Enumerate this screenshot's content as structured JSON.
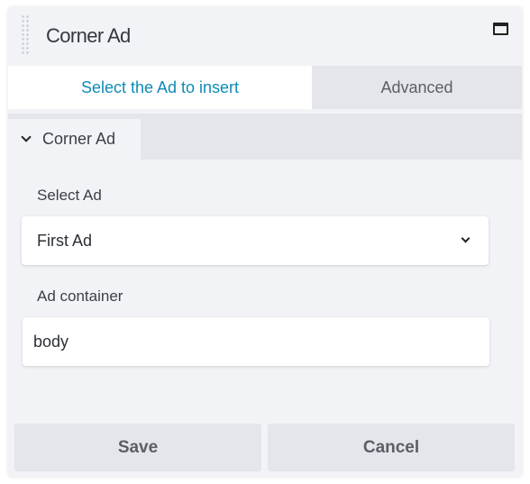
{
  "dialog": {
    "title": "Corner Ad",
    "maximize_icon": "maximize-icon"
  },
  "tabs": [
    {
      "label": "Select the Ad to insert",
      "active": true
    },
    {
      "label": "Advanced",
      "active": false
    }
  ],
  "section": {
    "label": "Corner Ad",
    "icon": "chevron-down-icon"
  },
  "fields": {
    "select_ad": {
      "label": "Select Ad",
      "value": "First Ad"
    },
    "ad_container": {
      "label": "Ad container",
      "value": "body"
    }
  },
  "buttons": {
    "save": "Save",
    "cancel": "Cancel"
  },
  "colors": {
    "accent": "#0e8bb6",
    "panel_bg": "#f2f3f6",
    "inactive_bg": "#e4e6eb"
  }
}
